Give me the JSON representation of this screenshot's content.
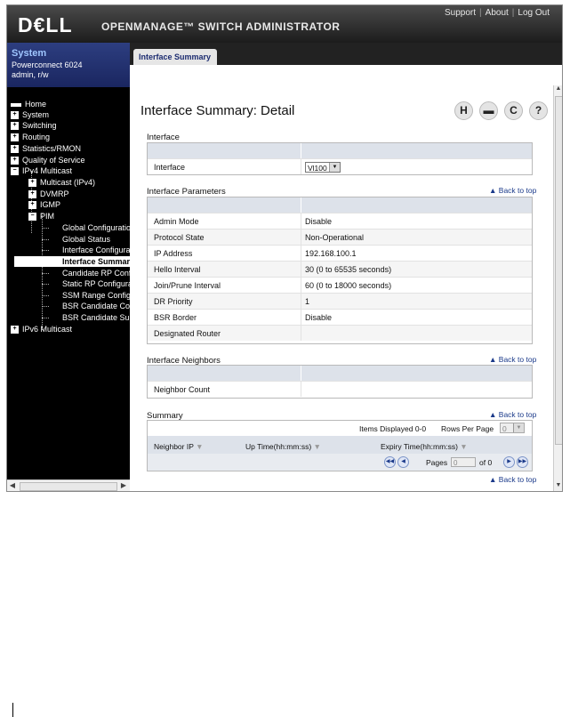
{
  "header": {
    "logo": "D€LL",
    "app_title": "OPENMANAGE™ SWITCH ADMINISTRATOR",
    "links": [
      "Support",
      "About",
      "Log Out"
    ]
  },
  "system_info": {
    "title": "System",
    "model": "Powerconnect 6024",
    "user": "admin, r/w"
  },
  "nav": [
    {
      "label": "Home",
      "expander": "home"
    },
    {
      "label": "System",
      "expander": "+"
    },
    {
      "label": "Switching",
      "expander": "+"
    },
    {
      "label": "Routing",
      "expander": "+"
    },
    {
      "label": "Statistics/RMON",
      "expander": "+"
    },
    {
      "label": "Quality of Service",
      "expander": "+"
    },
    {
      "label": "IPv4 Multicast",
      "expander": "-"
    },
    {
      "label": "Multicast (IPv4)",
      "expander": "+"
    },
    {
      "label": "DVMRP",
      "expander": "+"
    },
    {
      "label": "IGMP",
      "expander": "+"
    },
    {
      "label": "PIM",
      "expander": "-"
    },
    {
      "label": "Global Configuration",
      "expander": ""
    },
    {
      "label": "Global Status",
      "expander": ""
    },
    {
      "label": "Interface Configuration",
      "expander": ""
    },
    {
      "label": "Interface Summary",
      "expander": "",
      "selected": true
    },
    {
      "label": "Candidate RP Configuration",
      "expander": ""
    },
    {
      "label": "Static RP Configuration",
      "expander": ""
    },
    {
      "label": "SSM Range Configuration",
      "expander": ""
    },
    {
      "label": "BSR Candidate Configuration",
      "expander": ""
    },
    {
      "label": "BSR Candidate Summary",
      "expander": ""
    },
    {
      "label": "IPv6 Multicast",
      "expander": "+"
    }
  ],
  "tab": {
    "label": "Interface Summary"
  },
  "page": {
    "title": "Interface Summary: Detail",
    "toolbar_icons": [
      "save-icon",
      "print-icon",
      "refresh-icon",
      "help-icon"
    ],
    "back_to_top": "Back to top"
  },
  "interface_section": {
    "title": "Interface",
    "label": "Interface",
    "value": "Vl100"
  },
  "params_section": {
    "title": "Interface Parameters",
    "rows": [
      {
        "label": "Admin Mode",
        "value": "Disable"
      },
      {
        "label": "Protocol State",
        "value": "Non-Operational"
      },
      {
        "label": "IP Address",
        "value": "192.168.100.1"
      },
      {
        "label": "Hello Interval",
        "value": "30  (0 to 65535 seconds)"
      },
      {
        "label": "Join/Prune Interval",
        "value": "60  (0 to 18000 seconds)"
      },
      {
        "label": "DR Priority",
        "value": "1"
      },
      {
        "label": "BSR Border",
        "value": "Disable"
      },
      {
        "label": "Designated Router",
        "value": ""
      }
    ]
  },
  "neighbors_section": {
    "title": "Interface Neighbors",
    "label": "Neighbor Count",
    "value": ""
  },
  "summary_section": {
    "title": "Summary",
    "items_displayed": "Items Displayed 0-0",
    "rows_per_page_label": "Rows Per Page",
    "rows_per_page_value": "0",
    "columns": [
      "Neighbor IP",
      "Up Time(hh:mm:ss)",
      "Expiry Time(hh:mm:ss)"
    ],
    "pages_label": "Pages",
    "page_value": "0",
    "of_label": "of 0"
  }
}
